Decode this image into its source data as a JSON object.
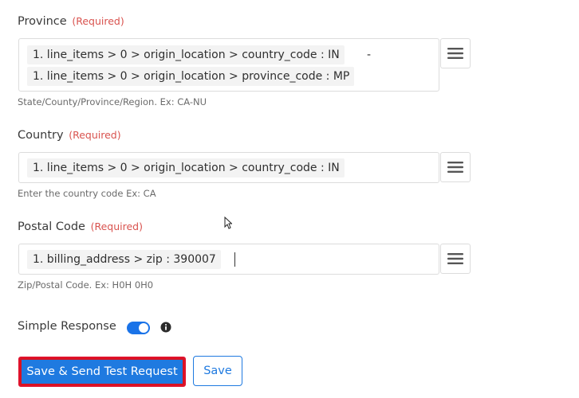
{
  "fields": {
    "province": {
      "label": "Province",
      "required": "(Required)",
      "tokens": [
        "1. line_items > 0 > origin_location > country_code : IN",
        "1. line_items > 0 > origin_location > province_code : MP"
      ],
      "separator": "-",
      "hint": "State/County/Province/Region. Ex: CA-NU"
    },
    "country": {
      "label": "Country",
      "required": "(Required)",
      "tokens": [
        "1. line_items > 0 > origin_location > country_code : IN"
      ],
      "hint": "Enter the country code Ex: CA"
    },
    "postal_code": {
      "label": "Postal Code",
      "required": "(Required)",
      "tokens": [
        "1. billing_address > zip : 390007"
      ],
      "hint": "Zip/Postal Code. Ex: H0H 0H0"
    }
  },
  "simple_response": {
    "label": "Simple Response",
    "enabled": true,
    "toggle_color": "#1a73e8",
    "info_icon": "info-circle-icon"
  },
  "actions": {
    "save_and_send_label": "Save & Send Test Request",
    "save_label": "Save",
    "primary_color": "#1f7ae0",
    "highlight_color": "#e0132d"
  },
  "icons": {
    "field_menu": "hamburger-menu-icon",
    "mouse_pointer": "mouse-pointer-icon"
  }
}
